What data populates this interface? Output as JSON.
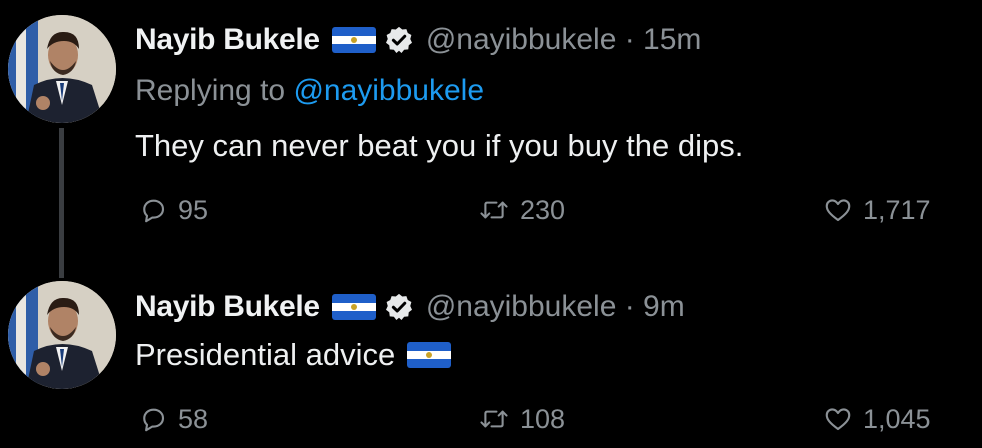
{
  "tweets": [
    {
      "display_name": "Nayib Bukele",
      "handle_time": "@nayibbukele · 15m",
      "replying_prefix": "Replying to",
      "replying_mention": "@nayibbukele",
      "text": "They can never beat you if you buy the dips.",
      "reply_count": "95",
      "retweet_count": "230",
      "like_count": "1,717"
    },
    {
      "display_name": "Nayib Bukele",
      "handle_time": "@nayibbukele · 9m",
      "text": "Presidential advice",
      "reply_count": "58",
      "retweet_count": "108",
      "like_count": "1,045"
    }
  ],
  "icons": {
    "flag": "el-salvador-flag-icon",
    "verified": "verified-badge-icon",
    "reply": "reply-icon",
    "retweet": "retweet-icon",
    "like": "heart-icon"
  },
  "colors": {
    "background": "#000000",
    "text_primary": "#e7e9ea",
    "text_secondary": "#8b9196",
    "link": "#1d9bf0",
    "flag_blue": "#1f5fc9"
  }
}
